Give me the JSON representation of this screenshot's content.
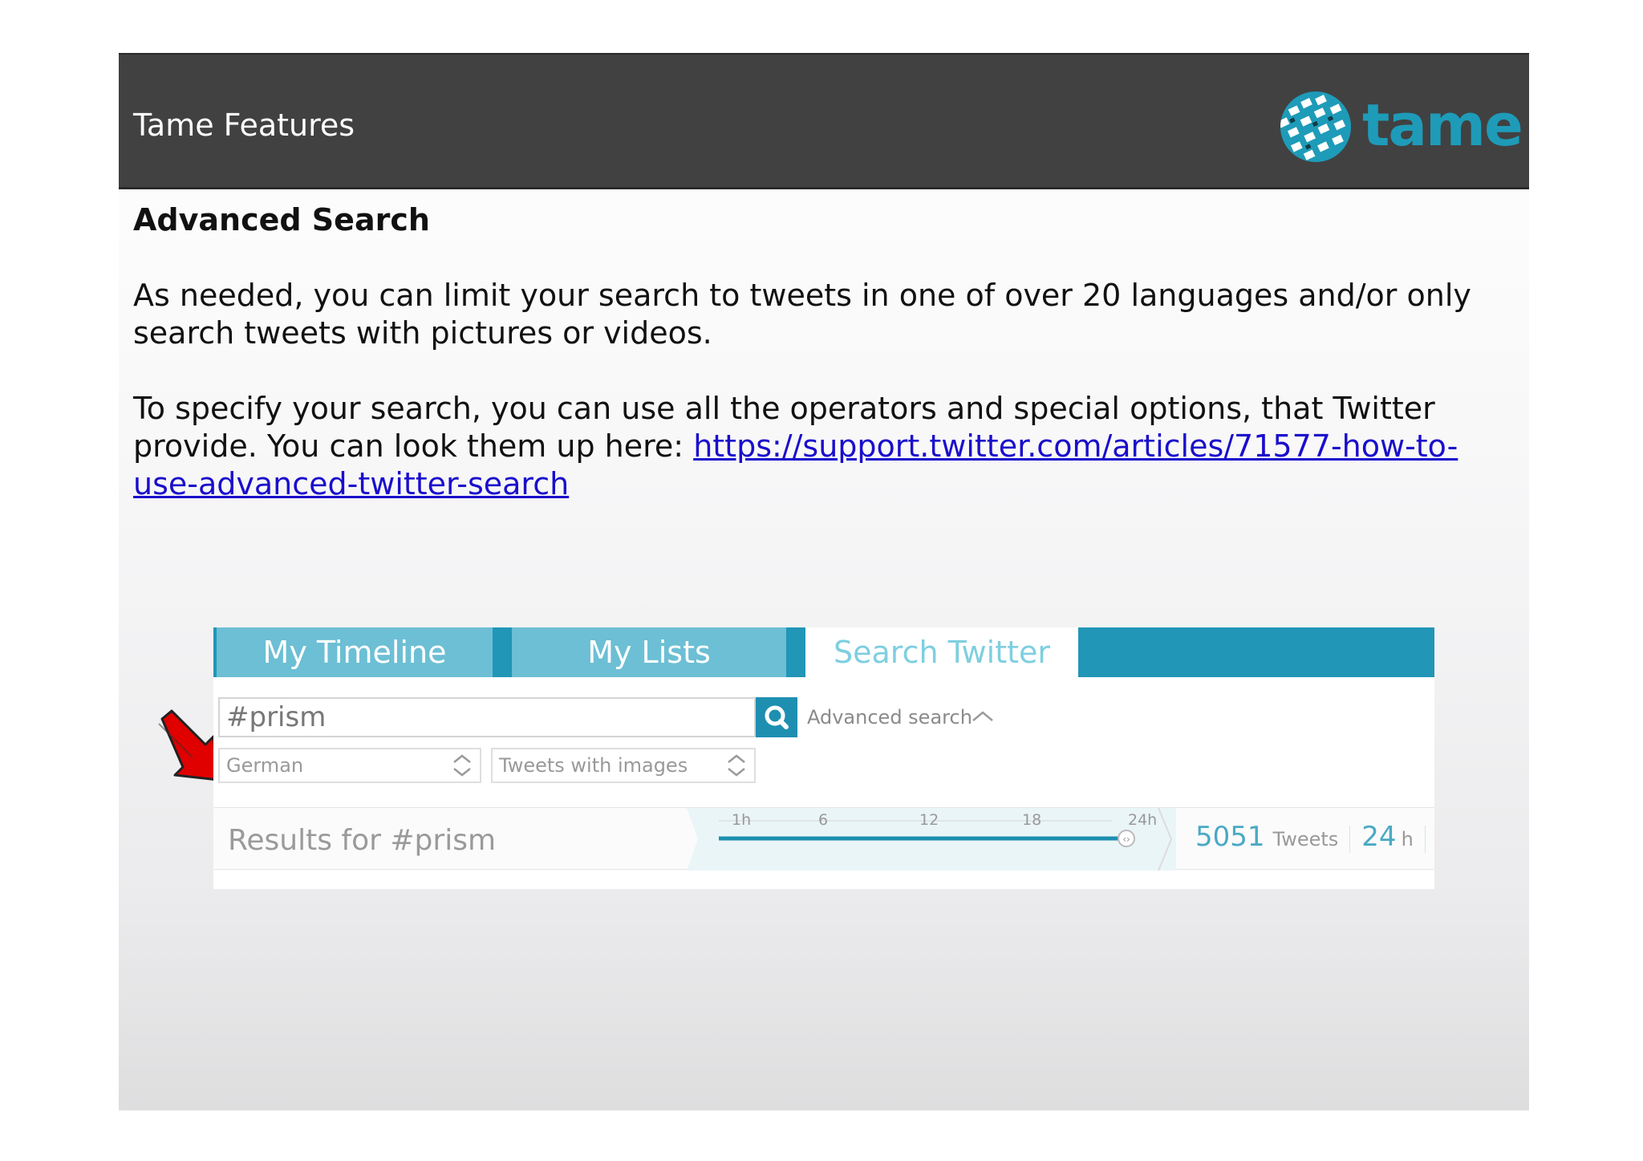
{
  "header": {
    "title": "Tame Features",
    "logo_text": "tame"
  },
  "section_title": "Advanced Search",
  "paragraph1": "As needed, you can limit your search to tweets in one of over 20 languages and/or only search tweets with pictures or videos.",
  "paragraph2": {
    "text": "To specify your search, you can use all the operators and special options, that Twitter provide. You can look them up here: ",
    "link": "https://support.twitter.com/articles/71577-how-to-use-advanced-twitter-search"
  },
  "tabs": [
    {
      "label": "My Timeline"
    },
    {
      "label": "My Lists"
    },
    {
      "label": "Search Twitter",
      "active": true
    }
  ],
  "search": {
    "query": "#prism",
    "advanced_label": "Advanced search"
  },
  "filters": {
    "language": "German",
    "media": "Tweets with images"
  },
  "results": {
    "label": "Results for #prism",
    "timeline_ticks": [
      "1h",
      "6",
      "12",
      "18",
      "24h"
    ],
    "count": "5051",
    "count_label": "Tweets",
    "hours": "24",
    "hours_unit": "h"
  },
  "colors": {
    "header_bg": "#414141",
    "brand": "#1e9bb8",
    "tab_inactive": "#6cbfd4",
    "tab_bar": "#2196b6",
    "annotation_arrow": "#e00000"
  }
}
